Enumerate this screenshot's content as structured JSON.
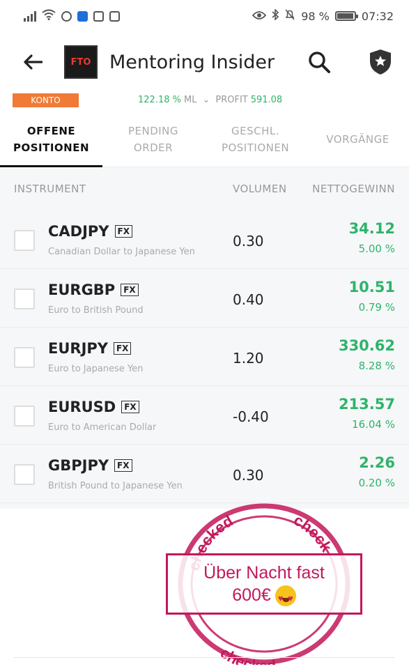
{
  "statusbar": {
    "battery_pct": "98 %",
    "time": "07:32"
  },
  "appbar": {
    "title": "Mentoring Insider",
    "logo_text": "FTO"
  },
  "summary": {
    "konto_label": "KONTO",
    "ml_value": "122.18 %",
    "ml_label": "ML",
    "chevron": "⌄",
    "profit_label": "PROFIT",
    "profit_value": "591.08"
  },
  "tabs": [
    {
      "l1": "OFFENE",
      "l2": "POSITIONEN",
      "active": true
    },
    {
      "l1": "PENDING",
      "l2": "ORDER",
      "active": false
    },
    {
      "l1": "GESCHL.",
      "l2": "POSITIONEN",
      "active": false
    },
    {
      "l1": "VORGÄNGE",
      "l2": "",
      "active": false
    }
  ],
  "columns": {
    "instrument": "INSTRUMENT",
    "volume": "VOLUMEN",
    "net": "NETTOGEWINN"
  },
  "positions": [
    {
      "symbol": "CADJPY",
      "badge": "FX",
      "desc": "Canadian Dollar to Japanese Yen",
      "volume": "0.30",
      "gain": "34.12",
      "pct": "5.00 %"
    },
    {
      "symbol": "EURGBP",
      "badge": "FX",
      "desc": "Euro to British Pound",
      "volume": "0.40",
      "gain": "10.51",
      "pct": "0.79 %"
    },
    {
      "symbol": "EURJPY",
      "badge": "FX",
      "desc": "Euro to Japanese Yen",
      "volume": "1.20",
      "gain": "330.62",
      "pct": "8.28 %"
    },
    {
      "symbol": "EURUSD",
      "badge": "FX",
      "desc": "Euro to American Dollar",
      "volume": "-0.40",
      "gain": "213.57",
      "pct": "16.04 %"
    },
    {
      "symbol": "GBPJPY",
      "badge": "FX",
      "desc": "British Pound to Japanese Yen",
      "volume": "0.30",
      "gain": "2.26",
      "pct": "0.20 %"
    }
  ],
  "stamp": {
    "ring_text_top": "checked",
    "ring_text_right": "check",
    "ring_text_bottom": "checked",
    "line1": "Über Nacht fast",
    "line2": "600€"
  },
  "colors": {
    "profit_green": "#2eb46a",
    "konto_orange": "#f07a36",
    "stamp_pink": "#c2185b"
  }
}
